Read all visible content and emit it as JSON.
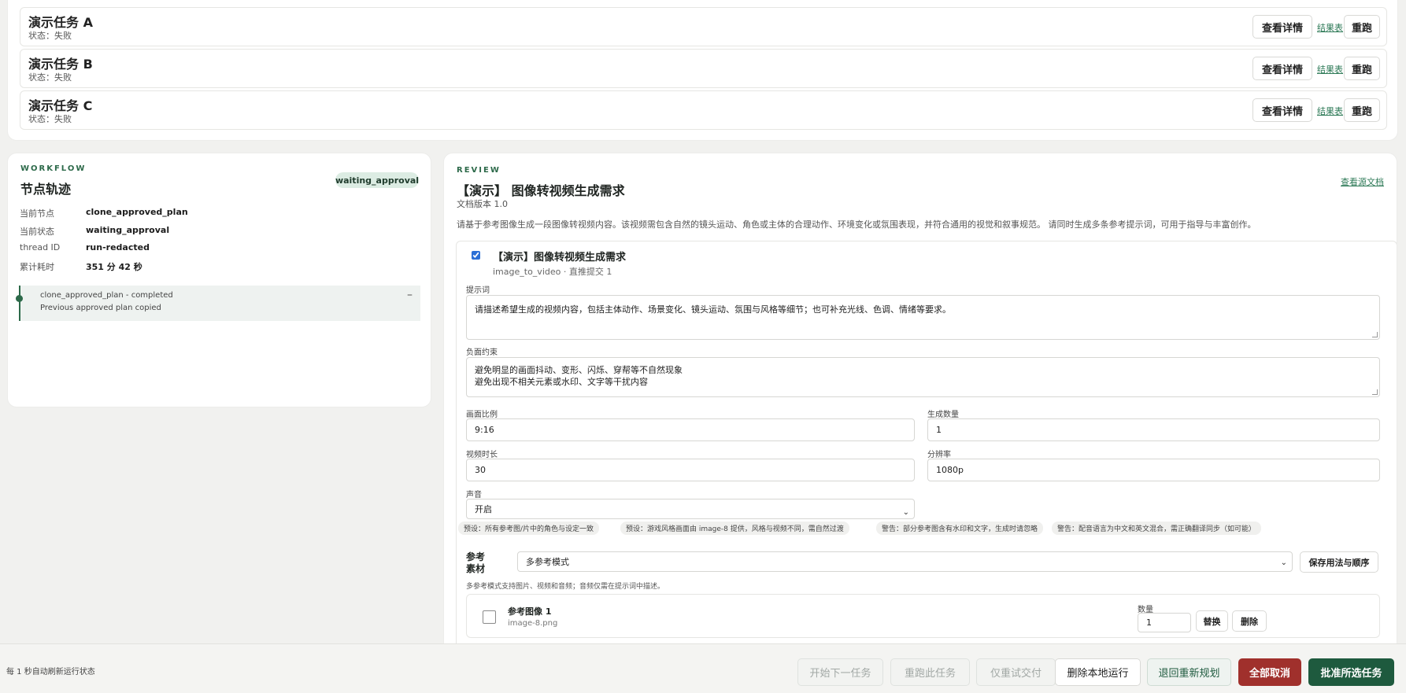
{
  "tasks": [
    {
      "title": "演示任务 A",
      "status": "状态：失败"
    },
    {
      "title": "演示任务 B",
      "status": "状态：失败"
    },
    {
      "title": "演示任务 C",
      "status": "状态：失败"
    }
  ],
  "task_actions": {
    "detail": "查看详情",
    "results": "结果表",
    "rerun": "重跑"
  },
  "workflow": {
    "eyebrow": "WORKFLOW",
    "title": "节点轨迹",
    "status_badge": "waiting_approval",
    "fields": [
      {
        "label": "当前节点",
        "value": "clone_approved_plan"
      },
      {
        "label": "当前状态",
        "value": "waiting_approval"
      },
      {
        "label": "thread ID",
        "value": "run-redacted"
      },
      {
        "label": "累计耗时",
        "value": "351 分 42 秒"
      }
    ],
    "trace": {
      "line1": "clone_approved_plan - completed",
      "line2": "Previous approved plan copied",
      "collapse": "–"
    }
  },
  "review": {
    "eyebrow": "REVIEW",
    "title": "【演示】 图像转视频生成需求",
    "version": "文档版本 1.0",
    "source_link": "查看源文档",
    "description": "请基于参考图像生成一段图像转视频内容。该视频需包含自然的镜头运动、角色或主体的合理动作、环境变化或氛围表现，并符合通用的视觉和叙事规范。 请同时生成多条参考提示词，可用于指导与丰富创作。",
    "item": {
      "checked": true,
      "title": "【演示】图像转视频生成需求",
      "subtitle": "image_to_video · 直推提交 1",
      "prompt_label": "提示词",
      "prompt_value": "请描述希望生成的视频内容，包括主体动作、场景变化、镜头运动、氛围与风格等细节；也可补充光线、色调、情绪等要求。",
      "negative_label": "负面约束",
      "negative_line1": "避免明显的画面抖动、变形、闪烁、穿帮等不自然现象",
      "negative_line2": "避免出现不相关元素或水印、文字等干扰内容",
      "aspect_label": "画面比例",
      "aspect_value": "9:16",
      "count_label": "生成数量",
      "count_value": "1",
      "duration_label": "视频时长",
      "duration_value": "30",
      "resolution_label": "分辨率",
      "resolution_value": "1080p",
      "audio_label": "声音",
      "audio_value": "开启",
      "chips": [
        "预设：所有参考图/片中的角色与设定一致",
        "预设：游戏风格画面由 image-8 提供，风格与视频不同，需自然过渡",
        "警告：部分参考图含有水印和文字，生成时请忽略",
        "警告：配音语言为中文和英文混合，需正确翻译同步（如可能）"
      ],
      "ref_label": "参考素材",
      "ref_mode": "多参考模式",
      "ref_save": "保存用法与顺序",
      "ref_hint": "多参考模式支持图片、视频和音频；音频仅需在提示词中描述。",
      "ref_item": {
        "name": "参考图像 1",
        "file": "image-8.png",
        "qty_label": "数量",
        "qty_value": "1",
        "replace": "替换",
        "delete": "删除"
      }
    }
  },
  "bottom_bar": {
    "refresh_note": "每 1 秒自动刷新运行状态",
    "buttons": {
      "start_next": "开始下一任务",
      "rerun_this": "重跑此任务",
      "retry_delivery": "仅重试交付",
      "delete_local": "删除本地运行",
      "replan": "退回重新规划",
      "cancel_all": "全部取消",
      "approve_selected": "批准所选任务"
    }
  }
}
